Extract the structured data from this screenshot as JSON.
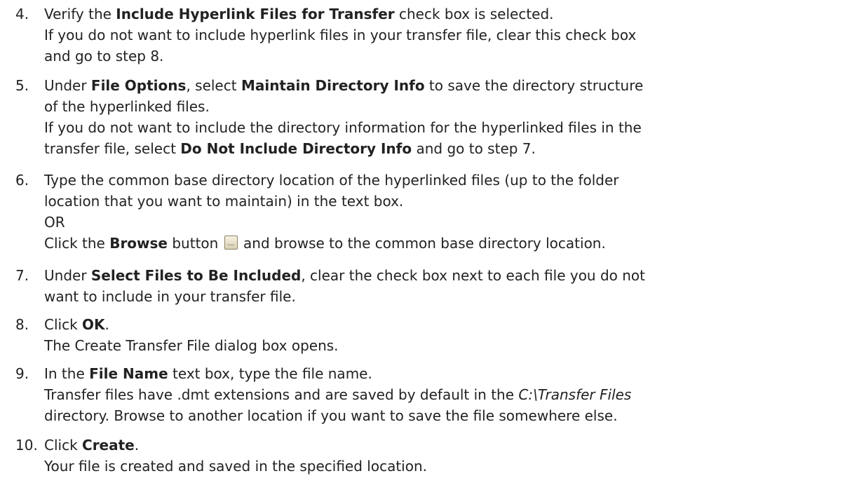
{
  "steps": [
    {
      "num": "4.",
      "lines": [
        [
          {
            "t": "Verify the "
          },
          {
            "t": "Include Hyperlink Files for Transfer",
            "b": true
          },
          {
            "t": " check box is selected."
          }
        ],
        [
          {
            "t": "If you do not want to include hyperlink files in your transfer file, clear this check box"
          }
        ],
        [
          {
            "t": "and go to step 8."
          }
        ]
      ]
    },
    {
      "num": "5.",
      "lines": [
        [
          {
            "t": "Under "
          },
          {
            "t": "File Options",
            "b": true
          },
          {
            "t": ", select "
          },
          {
            "t": "Maintain Directory Info",
            "b": true
          },
          {
            "t": " to save the directory structure"
          }
        ],
        [
          {
            "t": "of the hyperlinked files."
          }
        ],
        [
          {
            "t": "If you do not want to include the directory information for the hyperlinked files in the"
          }
        ],
        [
          {
            "t": "transfer file, select "
          },
          {
            "t": "Do Not Include Directory Info",
            "b": true
          },
          {
            "t": " and go to step 7."
          }
        ]
      ]
    },
    {
      "num": "6.",
      "lines": [
        [
          {
            "t": "Type the common base directory location of the hyperlinked files (up to the folder"
          }
        ],
        [
          {
            "t": "location that you want to maintain) in the text box."
          }
        ],
        [
          {
            "t": "OR"
          }
        ],
        [
          {
            "t": "Click the "
          },
          {
            "t": "Browse",
            "b": true
          },
          {
            "t": " button "
          },
          {
            "icon": "browse-button-icon",
            "glyph": "..."
          },
          {
            "t": " and browse to the common base directory location."
          }
        ]
      ]
    },
    {
      "num": "7.",
      "lines": [
        [
          {
            "t": "Under "
          },
          {
            "t": "Select Files to Be Included",
            "b": true
          },
          {
            "t": ", clear the check box next to each file you do not"
          }
        ],
        [
          {
            "t": "want to include in your transfer file."
          }
        ]
      ]
    },
    {
      "num": "8.",
      "lines": [
        [
          {
            "t": "Click "
          },
          {
            "t": "OK",
            "b": true
          },
          {
            "t": "."
          }
        ],
        [
          {
            "t": "The Create Transfer File dialog box opens."
          }
        ]
      ]
    },
    {
      "num": "9.",
      "lines": [
        [
          {
            "t": "In the "
          },
          {
            "t": "File Name",
            "b": true
          },
          {
            "t": " text box, type the file name."
          }
        ],
        [
          {
            "t": "Transfer files have .dmt extensions and are saved by default in the "
          },
          {
            "t": "C:\\Transfer Files",
            "i": true
          }
        ],
        [
          {
            "t": "directory. Browse to another location if you want to save the file somewhere else."
          }
        ]
      ]
    },
    {
      "num": "10.",
      "lines": [
        [
          {
            "t": "Click "
          },
          {
            "t": "Create",
            "b": true
          },
          {
            "t": "."
          }
        ],
        [
          {
            "t": "Your file is created and saved in the specified location."
          }
        ]
      ]
    }
  ]
}
